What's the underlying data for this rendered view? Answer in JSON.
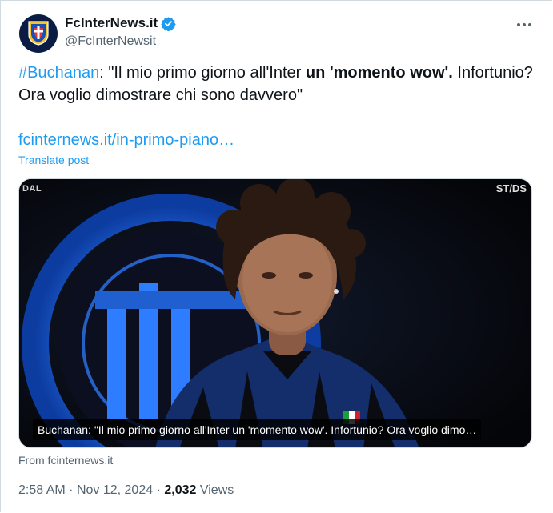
{
  "author": {
    "display_name": "FcInterNews.it",
    "handle": "@FcInterNewsit",
    "avatar_icon": "club-crest-icon",
    "verified_icon": "verified-badge-icon"
  },
  "more_icon": "more-options-icon",
  "tweet": {
    "hashtag": "#Buchanan",
    "text_part1": ": \"Il mio primo giorno all'Inter ",
    "text_bold": "un 'momento wow'.",
    "text_part2": " Infortunio? Ora voglio dimostrare chi sono davvero\"",
    "link": "fcinternews.it/in-primo-piano…",
    "translate_label": "Translate post"
  },
  "media": {
    "watermark_left": "DAL",
    "watermark_right": "ST/DS",
    "caption": "Buchanan: \"Il mio primo giorno all'Inter un 'momento wow'. Infortunio? Ora voglio dimo…"
  },
  "card_source": "From fcinternews.it",
  "meta": {
    "time": "2:58 AM",
    "separator": "·",
    "date": "Nov 12, 2024",
    "views_count": "2,032",
    "views_label": "Views"
  },
  "colors": {
    "link": "#1d9bf0",
    "secondary_text": "#536471",
    "primary_text": "#0f1419",
    "inter_blue": "#1e5fc0"
  }
}
